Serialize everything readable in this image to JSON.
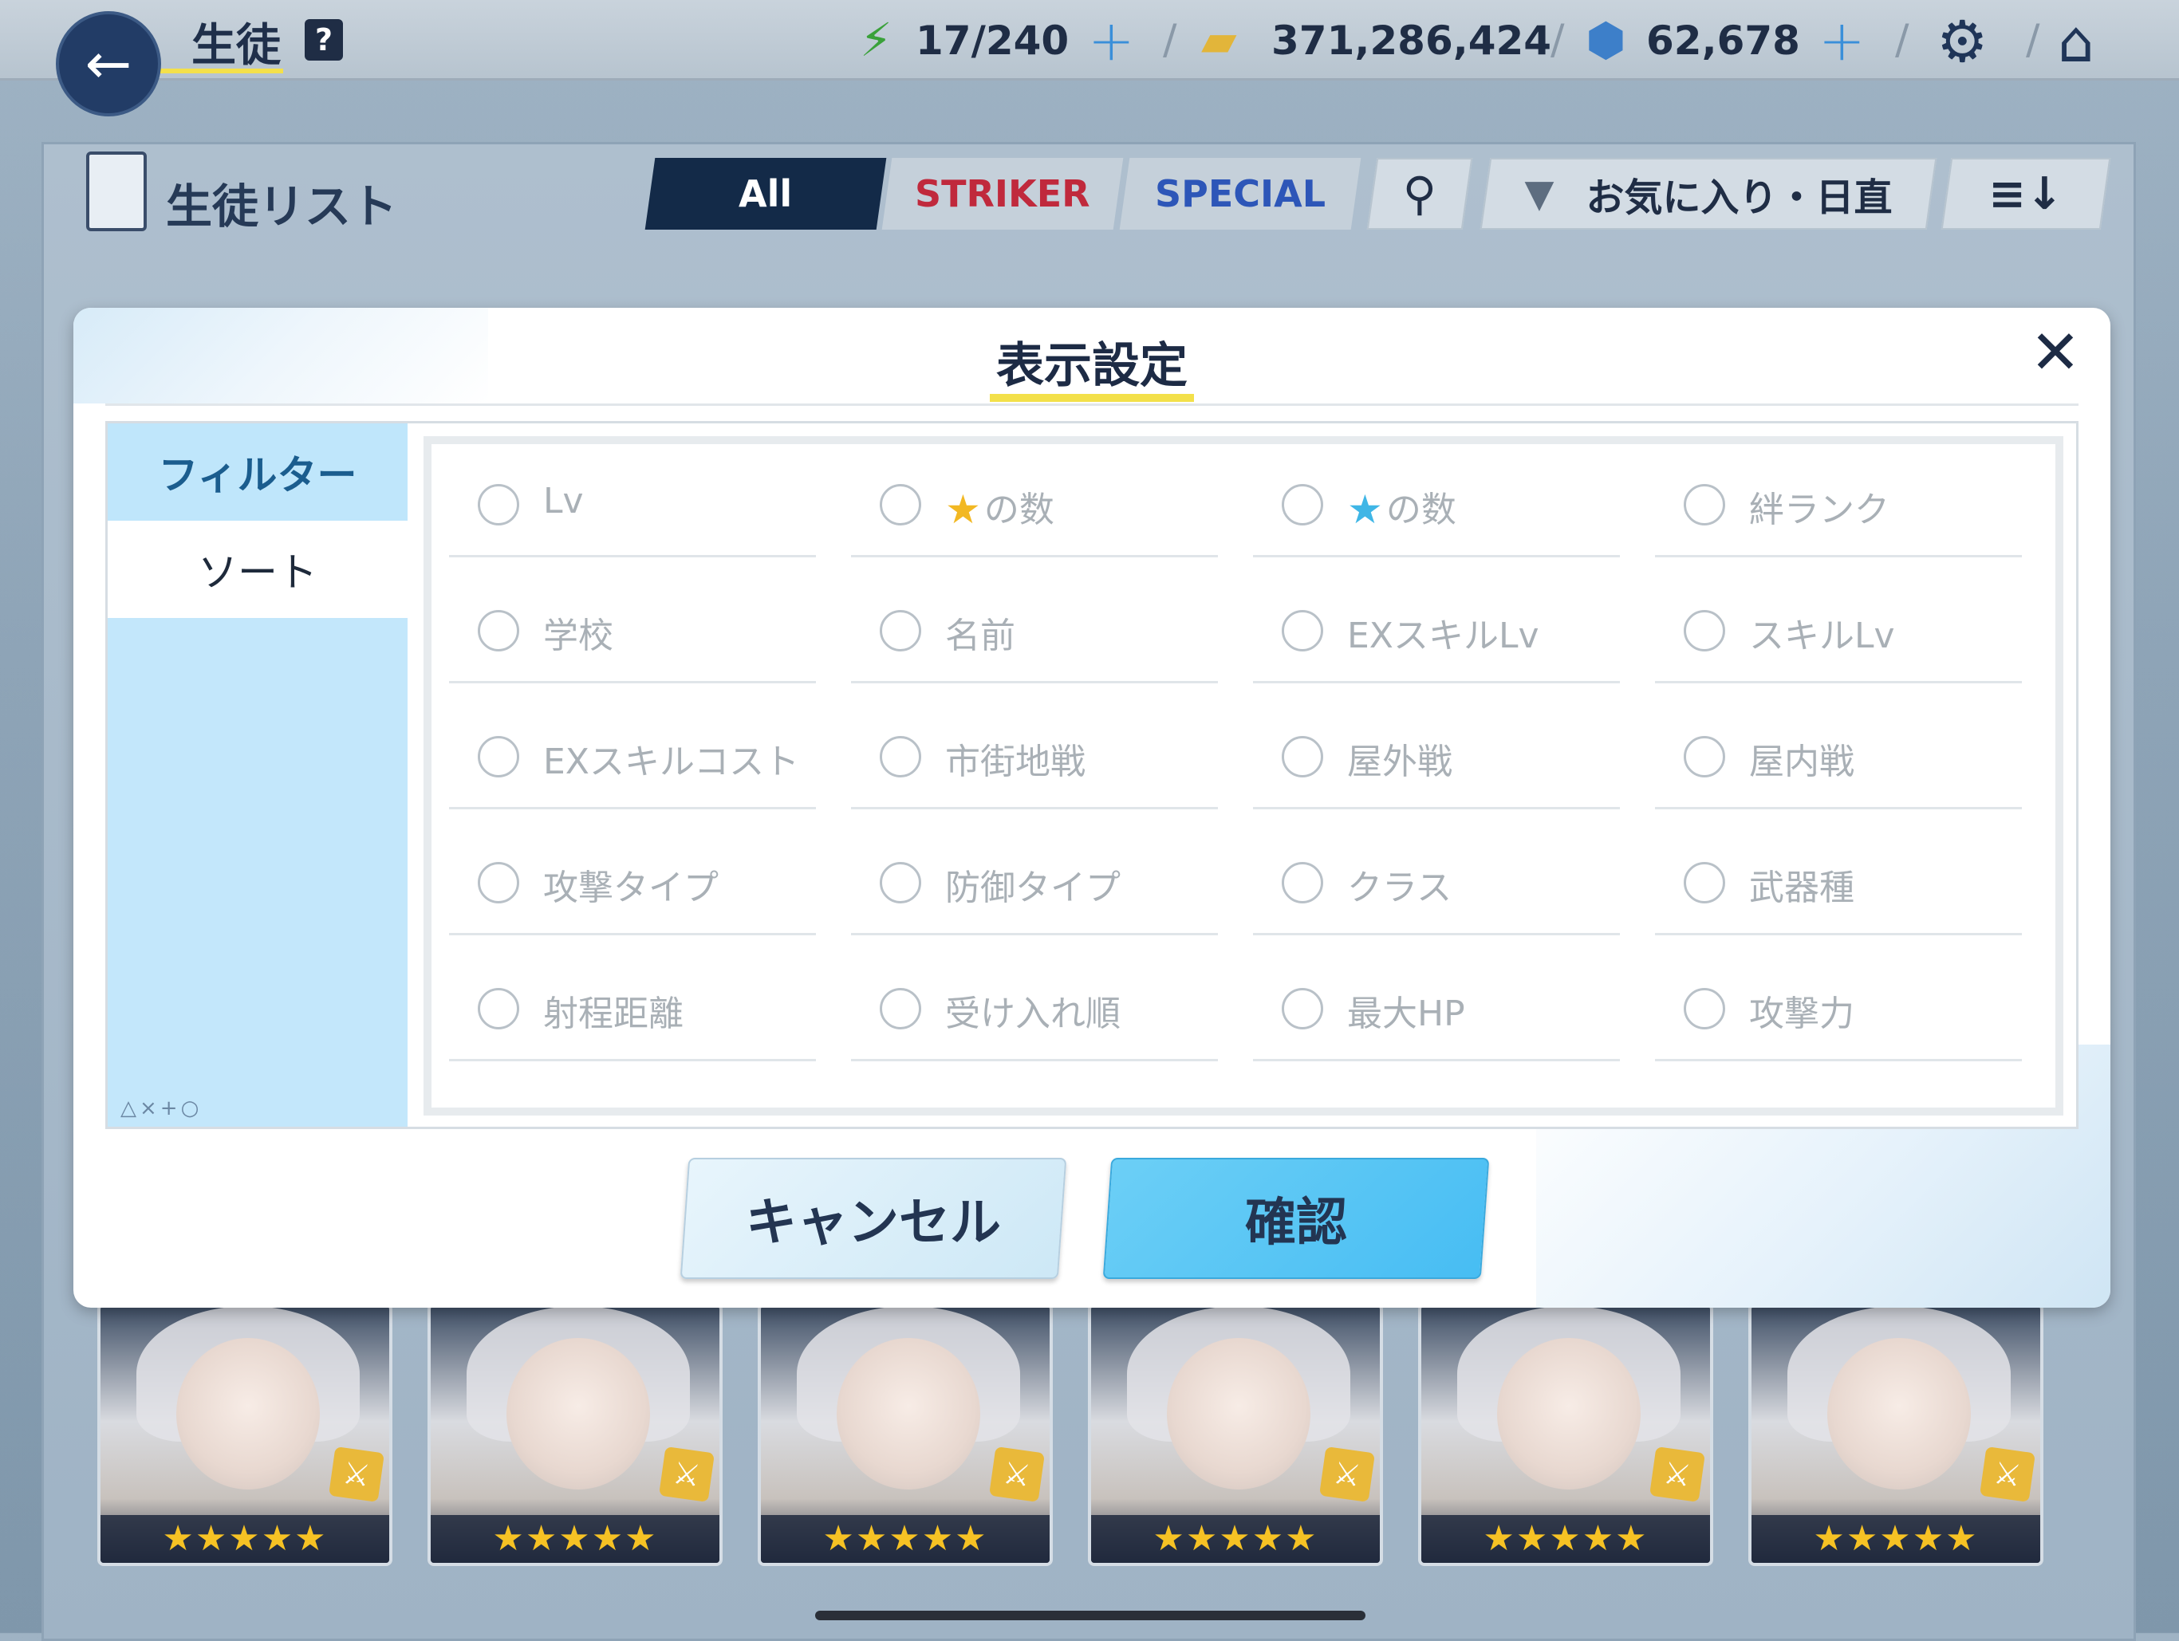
{
  "header": {
    "title": "生徒",
    "help_label": "?",
    "ap": "17/240",
    "credits": "371,286,424",
    "gems": "62,678"
  },
  "list": {
    "title": "生徒リスト",
    "tabs": {
      "all": "All",
      "striker": "STRIKER",
      "special": "SPECIAL"
    },
    "sort_filter_label": "お気に入り・日直"
  },
  "modal": {
    "title": "表示設定",
    "side_tabs": {
      "filter": "フィルター",
      "sort": "ソート"
    },
    "side_glyphs": "△×+○",
    "options": [
      {
        "label": "Lv"
      },
      {
        "label": "の数",
        "star": "gold"
      },
      {
        "label": "の数",
        "star": "blue"
      },
      {
        "label": "絆ランク"
      },
      {
        "label": "学校"
      },
      {
        "label": "名前"
      },
      {
        "label": "EXスキルLv"
      },
      {
        "label": "スキルLv"
      },
      {
        "label": "EXスキルコスト"
      },
      {
        "label": "市街地戦"
      },
      {
        "label": "屋外戦"
      },
      {
        "label": "屋内戦"
      },
      {
        "label": "攻撃タイプ"
      },
      {
        "label": "防御タイプ"
      },
      {
        "label": "クラス"
      },
      {
        "label": "武器種"
      },
      {
        "label": "射程距離"
      },
      {
        "label": "受け入れ順"
      },
      {
        "label": "最大HP"
      },
      {
        "label": "攻撃力"
      }
    ],
    "cancel_label": "キャンセル",
    "confirm_label": "確認"
  },
  "cards": [
    {
      "stars": "★★★★★"
    },
    {
      "stars": "★★★★★"
    },
    {
      "stars": "★★★★★"
    },
    {
      "stars": "★★★★★"
    },
    {
      "stars": "★★★★★"
    },
    {
      "stars": "★★★★★"
    }
  ],
  "colors": {
    "accent_blue": "#47bdf3",
    "title_underline": "#f3e04a",
    "striker_red": "#c0293c",
    "special_blue": "#2d56b8",
    "side_bg": "#c3e7fb"
  }
}
